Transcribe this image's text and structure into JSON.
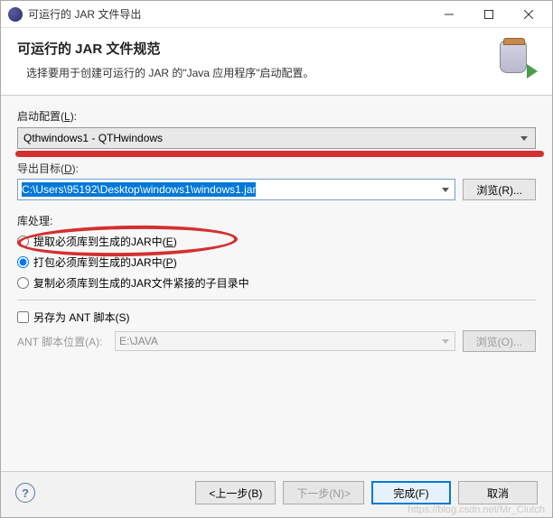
{
  "window": {
    "title": "可运行的 JAR 文件导出"
  },
  "banner": {
    "title": "可运行的 JAR 文件规范",
    "desc": "选择要用于创建可运行的 JAR 的\"Java 应用程序\"启动配置。"
  },
  "launch": {
    "label_pre": "启动配置(",
    "label_u": "L",
    "label_post": "):",
    "value": "Qthwindows1 - QTHwindows"
  },
  "export_dest": {
    "label_pre": "导出目标(",
    "label_u": "D",
    "label_post": "):",
    "value": "C:\\Users\\95192\\Desktop\\windows1\\windows1.jar",
    "browse": "浏览(R)..."
  },
  "libs": {
    "label": "库处理:",
    "opt1_pre": "提取必须库到生成的JAR中(",
    "opt1_u": "E",
    "opt1_post": ")",
    "opt2_pre": "打包必须库到生成的JAR中(",
    "opt2_u": "P",
    "opt2_post": ")",
    "opt3": "复制必须库到生成的JAR文件紧接的子目录中"
  },
  "ant": {
    "check_pre": "另存为 ANT 脚本(",
    "check_u": "S",
    "check_post": ")",
    "loc_label": "ANT 脚本位置(A):",
    "loc_value": "E:\\JAVA",
    "browse": "浏览(O)..."
  },
  "footer": {
    "back": "<上一步(B)",
    "next": "下一步(N)>",
    "finish": "完成(F)",
    "cancel": "取消"
  },
  "watermark": "https://blog.csdn.net/Mr_Clutch"
}
